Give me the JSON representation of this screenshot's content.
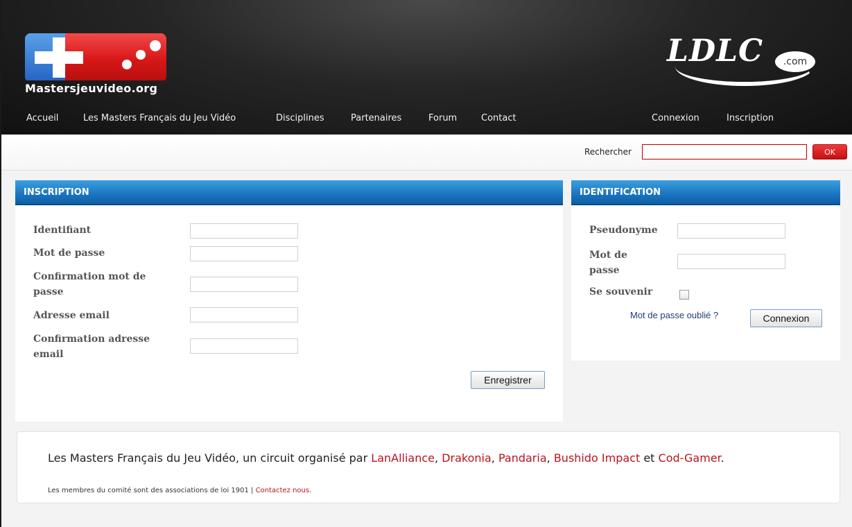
{
  "header": {
    "site_name": "Mastersjeuvideo.org",
    "sponsor_logo": "LDLC",
    "sponsor_logo_suffix": ".com",
    "nav": [
      {
        "label": "Accueil"
      },
      {
        "label": "Les Masters Français du Jeu Vidéo"
      },
      {
        "label": "Disciplines"
      },
      {
        "label": "Partenaires"
      },
      {
        "label": "Forum"
      },
      {
        "label": "Contact"
      }
    ],
    "account_nav": [
      {
        "label": "Connexion"
      },
      {
        "label": "Inscription"
      }
    ]
  },
  "search": {
    "label": "Rechercher",
    "value": "",
    "button": "OK"
  },
  "inscription": {
    "title": "INSCRIPTION",
    "fields": [
      {
        "label": "Identifiant",
        "value": ""
      },
      {
        "label": "Mot de passe",
        "value": ""
      },
      {
        "label": "Confirmation mot de passe",
        "value": ""
      },
      {
        "label": "Adresse email",
        "value": ""
      },
      {
        "label": "Confirmation adresse email",
        "value": ""
      }
    ],
    "submit": "Enregistrer"
  },
  "identification": {
    "title": "IDENTIFICATION",
    "fields": [
      {
        "label": "Pseudonyme",
        "value": ""
      },
      {
        "label": "Mot de passe",
        "value": ""
      }
    ],
    "remember_label": "Se souvenir",
    "remember_checked": false,
    "forgot": "Mot de passe oublié ?",
    "submit": "Connexion"
  },
  "footer": {
    "intro": "Les Masters Français du Jeu Vidéo, un circuit organisé par",
    "organizers": [
      "LanAlliance",
      "Drakonia",
      "Pandaria",
      "Bushido Impact",
      "Cod-Gamer"
    ],
    "separator_comma": ",",
    "conjunction": "et",
    "end": ".",
    "sub_text": "Les membres du comité sont des associations de loi 1901 |",
    "contact_link": "Contactez nous",
    "sub_end": "."
  },
  "colors": {
    "header_bg": "#1a1a1a",
    "panel_header": "#1a74bf",
    "accent_red": "#b8141c",
    "ok_button": "#d11616"
  }
}
